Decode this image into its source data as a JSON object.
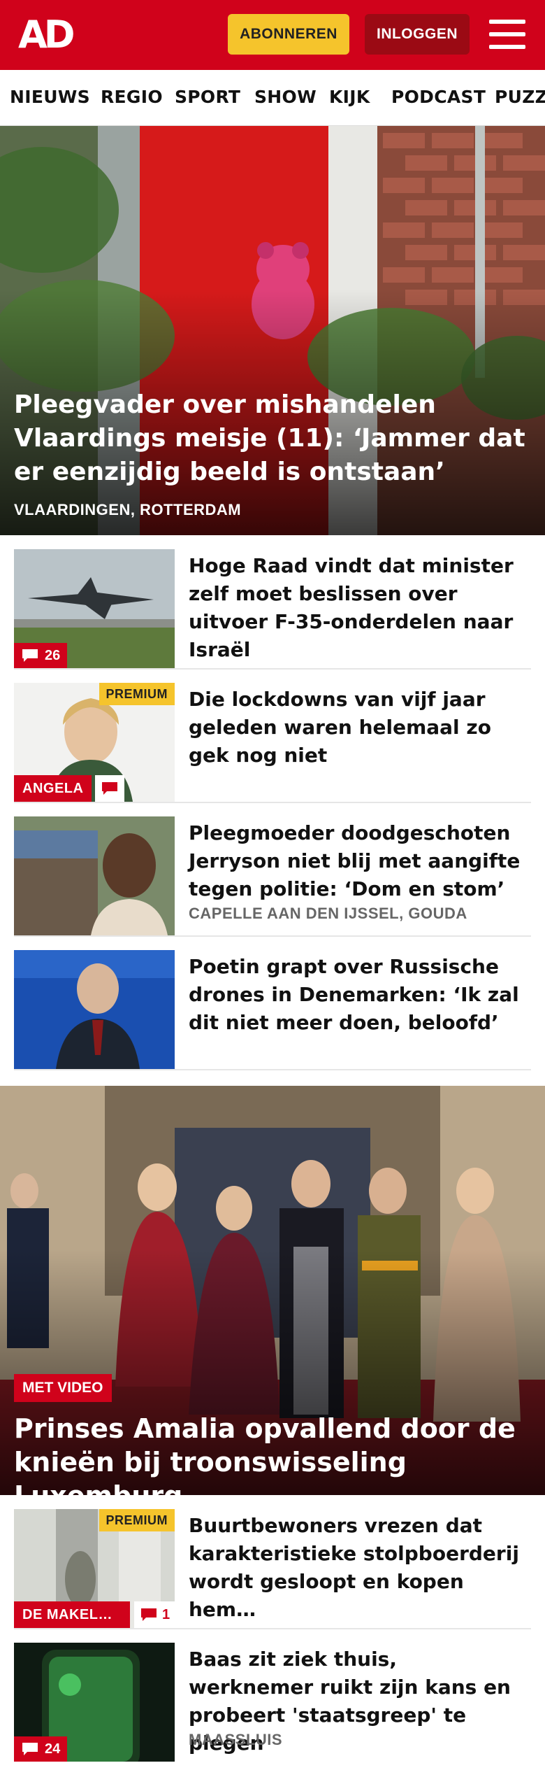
{
  "header": {
    "logo_text": "AD",
    "subscribe_label": "ABONNEREN",
    "login_label": "INLOGGEN",
    "brand_color": "#d0021b",
    "subscribe_color": "#f5c42c"
  },
  "nav": {
    "items": [
      "NIEUWS",
      "REGIO",
      "SPORT",
      "SHOW",
      "KIJK",
      "PODCAST",
      "PUZZ"
    ]
  },
  "hero": {
    "title": "Pleegvader over mishandelen Vlaardings meisje (11): ‘Jammer dat er eenzijdig beeld is ontstaan’",
    "location": "VLAARDINGEN, ROTTERDAM"
  },
  "articles": [
    {
      "title": "Hoge Raad vindt dat minister zelf moet beslissen over uitvoer F-35-onderdelen naar Israël",
      "comments": "26"
    },
    {
      "title": "Die lockdowns van vijf jaar geleden waren helemaal zo gek nog niet",
      "premium": "PREMIUM",
      "label": "ANGELA"
    },
    {
      "title": "Pleegmoeder doodgeschoten Jerryson niet blij met aangifte tegen politie: ‘Dom en stom’",
      "location": "CAPELLE AAN DEN IJSSEL, GOUDA"
    },
    {
      "title": "Poetin grapt over Russische drones in Denemarken: ‘Ik zal dit niet meer doen, beloofd’"
    },
    {
      "title": "Buurtbewoners vrezen dat karakteristieke stolpboerderij wordt gesloopt en kopen hem…",
      "premium": "PREMIUM",
      "label": "DE MAKEL…",
      "comments": "1"
    },
    {
      "title": "Baas zit ziek thuis, werknemer ruikt zijn kans en probeert 'staatsgreep' te plegen",
      "location": "MAASSLUIS",
      "comments": "24"
    }
  ],
  "hero2": {
    "tag": "MET VIDEO",
    "title": "Prinses Amalia opvallend door de knieën bij troonswisseling Luxemburg"
  }
}
